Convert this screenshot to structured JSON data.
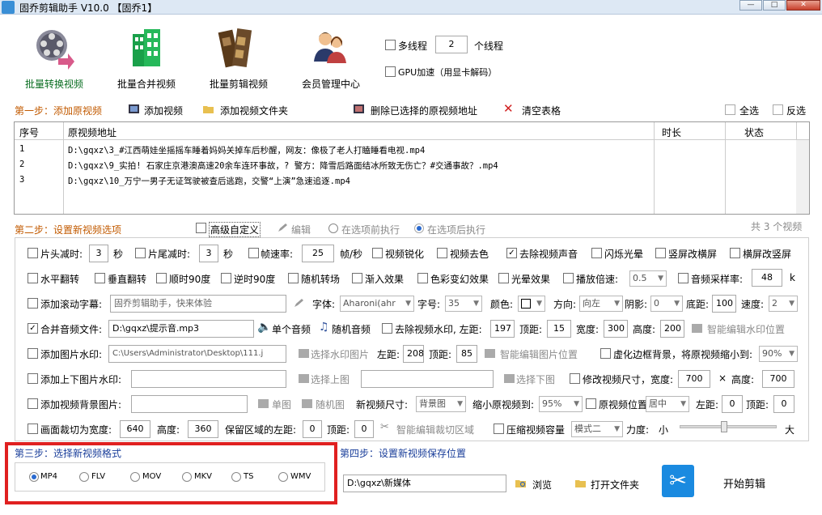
{
  "window": {
    "title": "固乔剪辑助手 V10.0 【固乔1】",
    "min": "—",
    "max": "□",
    "close": "✕"
  },
  "toolbar": {
    "batch_convert": "批量转换视频",
    "batch_merge": "批量合并视频",
    "batch_clip": "批量剪辑视频",
    "member": "会员管理中心",
    "multithread": "多线程",
    "thread_count": "2",
    "thread_unit": "个线程",
    "gpu": "GPU加速（用显卡解码）"
  },
  "step1": {
    "label": "第一步：添加原视频",
    "add_video": "添加视频",
    "add_folder": "添加视频文件夹",
    "delete_selected": "删除已选择的原视频地址",
    "clear_table": "清空表格",
    "select_all": "全选",
    "invert": "反选"
  },
  "table": {
    "columns": [
      "序号",
      "原视频地址",
      "时长",
      "状态"
    ],
    "rows": [
      {
        "no": "1",
        "path": "D:\\gqxz\\3_#江西萌娃坐摇摇车睡着妈妈关掉车后秒醒，网友：像极了老人打瞌睡看电视.mp4",
        "duration": "",
        "status": ""
      },
      {
        "no": "2",
        "path": "D:\\gqxz\\9_实拍! 石家庄京港澳高速20余车连环事故，? 警方：降雪后路面结冰所致无伤亡？#交通事故？.mp4",
        "duration": "",
        "status": ""
      },
      {
        "no": "3",
        "path": "D:\\gqxz\\10_万宁一男子无证驾驶被查后逃跑，交警“上演”急速追逐.mp4",
        "duration": "",
        "status": ""
      }
    ]
  },
  "step2": {
    "label": "第二步：设置新视频选项",
    "advanced": "高级自定义",
    "edit": "编辑",
    "before_merge": "在选项前执行",
    "after_merge": "在选项后执行",
    "count": "共 3 个视频"
  },
  "opts": {
    "head_cut": "片头减时:",
    "head_val": "3",
    "sec1": "秒",
    "tail_cut": "片尾减时:",
    "tail_val": "3",
    "sec2": "秒",
    "fps": "帧速率:",
    "fps_val": "25",
    "fps_unit": "帧/秒",
    "sharpen": "视频锐化",
    "decolor": "视频去色",
    "mute": "去除视频声音",
    "flash": "闪烁光晕",
    "v2h": "竖屏改横屏",
    "h2v": "横屏改竖屏",
    "hflip": "水平翻转",
    "vflip": "垂直翻转",
    "cw90": "顺时90度",
    "ccw90": "逆时90度",
    "random_trans": "随机转场",
    "fade_in": "渐入效果",
    "color_change": "色彩变幻效果",
    "halo": "光晕效果",
    "speed": "播放倍速:",
    "speed_val": "0.5",
    "sample_rate": "音频采样率:",
    "sample_val": "48",
    "sample_unit": "k",
    "scroll_sub": "添加滚动字幕:",
    "scroll_text": "固乔剪辑助手，快来体验",
    "font": "字体:",
    "font_val": "Aharoni(ahr",
    "fsize": "字号:",
    "fsize_val": "35",
    "color": "颜色:",
    "direction": "方向:",
    "direction_val": "向左",
    "shadow": "阴影:",
    "shadow_val": "0",
    "bottom": "底距:",
    "bottom_val": "100",
    "speed2": "速度:",
    "speed2_val": "2",
    "merge_audio": "合并音频文件:",
    "audio_path": "D:\\gqxz\\提示音.mp3",
    "single_audio": "单个音频",
    "random_audio": "随机音频",
    "remove_wm": "去除视频水印, 左距:",
    "wm_left": "197",
    "wm_top_lbl": "顶距:",
    "wm_top": "15",
    "wm_w_lbl": "宽度:",
    "wm_w": "300",
    "wm_h_lbl": "高度:",
    "wm_h": "200",
    "smart_wm": "智能编辑水印位置",
    "img_wm": "添加图片水印:",
    "img_path": "C:\\Users\\Administrator\\Desktop\\111.j",
    "choose_wm": "选择水印图片",
    "img_left_lbl": "左距:",
    "img_left": "208",
    "img_top_lbl": "顶距:",
    "img_top": "85",
    "smart_img": "智能编辑图片位置",
    "blur_bg": "虚化边框背景，将原视频缩小到:",
    "blur_val": "90%",
    "tb_wm": "添加上下图片水印:",
    "choose_top": "选择上图",
    "choose_bottom": "选择下图",
    "resize": "修改视频尺寸，宽度:",
    "resize_w": "700",
    "times": "×",
    "resize_h_lbl": "高度:",
    "resize_h": "700",
    "bg_img": "添加视频背景图片:",
    "single_img": "单图",
    "random_img": "随机图",
    "new_size": "新视频尺寸:",
    "new_size_val": "背景图",
    "shrink": "缩小原视频到:",
    "shrink_val": "95%",
    "pos": "原视频位置:",
    "pos_val": "居中",
    "left_lbl": "左距:",
    "left_val": "0",
    "top_lbl": "顶距:",
    "top_val": "0",
    "crop": "画面裁切为宽度:",
    "crop_w": "640",
    "crop_h_lbl": "高度:",
    "crop_h": "360",
    "keep_left": "保留区域的左距:",
    "keep_left_val": "0",
    "keep_top_lbl": "顶距:",
    "keep_top": "0",
    "smart_crop": "智能编辑裁切区域",
    "compress": "压缩视频容量",
    "compress_mode": "模式二",
    "strength": "力度:",
    "small": "小",
    "large": "大"
  },
  "step3": {
    "label": "第三步：选择新视频格式",
    "formats": [
      "MP4",
      "FLV",
      "MOV",
      "MKV",
      "TS",
      "WMV"
    ],
    "selected": "MP4"
  },
  "step4": {
    "label": "第四步：设置新视频保存位置",
    "path": "D:\\gqxz\\新媒体",
    "browse": "浏览",
    "open_folder": "打开文件夹",
    "start": "开始剪辑"
  }
}
